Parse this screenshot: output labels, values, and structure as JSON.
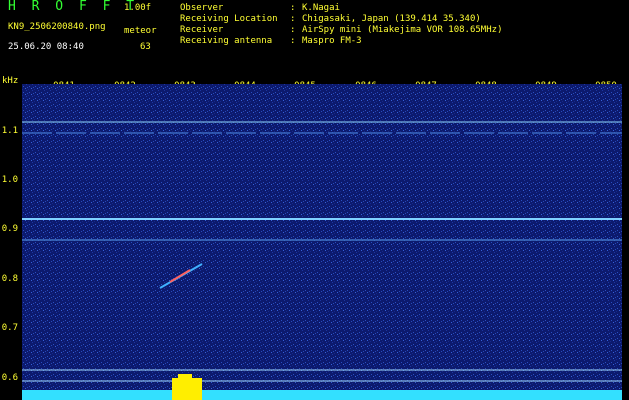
{
  "header": {
    "app_title": "H R O F F T",
    "version": "1.00f",
    "filename": "KN9_2506200840.png",
    "datetime": "25.06.20 08:40",
    "meteor_label": "meteor",
    "meteor_count": "63"
  },
  "info": [
    {
      "key": "Observer",
      "value": "K.Nagai"
    },
    {
      "key": "Receiving Location",
      "value": "Chigasaki, Japan (139.414 35.340)"
    },
    {
      "key": "Receiver",
      "value": "AirSpy mini (Miakejima VOR 108.65MHz)"
    },
    {
      "key": "Receiving antenna",
      "value": "Maspro FM-3"
    }
  ],
  "colon": ":",
  "axes": {
    "y_unit": "kHz",
    "y_ticks": [
      "1.1",
      "1.0",
      "0.9",
      "0.8",
      "0.7",
      "0.6"
    ],
    "x_ticks": [
      "0841",
      "0842",
      "0843",
      "0844",
      "0845",
      "0846",
      "0847",
      "0848",
      "0849",
      "0850"
    ]
  },
  "colors": {
    "background": "#000000",
    "spectrum_bg": "#0c1a6e",
    "label": "#ffff33",
    "title": "#33ff33",
    "signal_line": "#9fd0ff",
    "meteor": "#ff6060",
    "histogram": "#33e0ff",
    "histogram_peak": "#ffee00"
  }
}
